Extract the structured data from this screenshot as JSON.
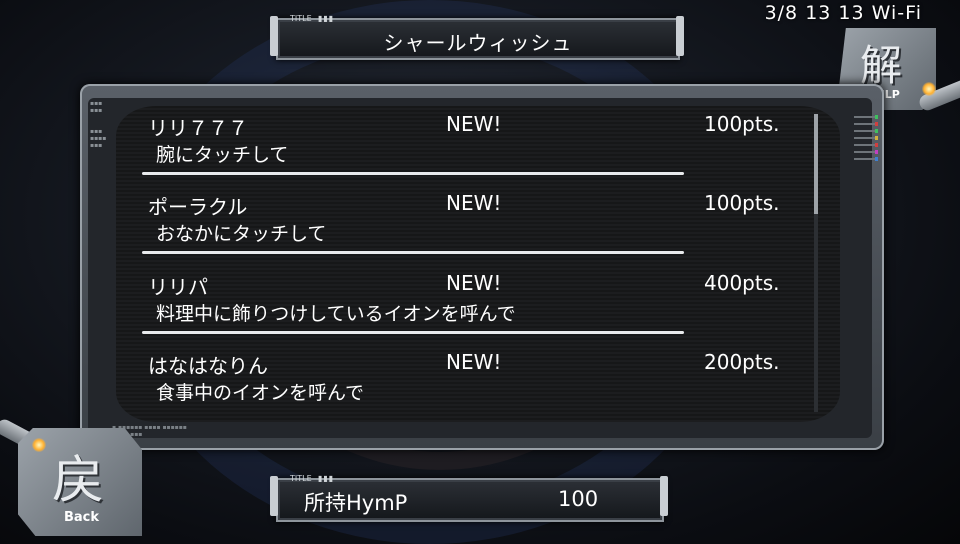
{
  "status_bar": {
    "date": "3/8",
    "hour": "13",
    "minute": "13",
    "network": "Wi-Fi"
  },
  "title_plate": {
    "tag": "TITLE",
    "title": "シャールウィッシュ"
  },
  "help_button": {
    "kanji": "解",
    "label": "HELP"
  },
  "back_button": {
    "kanji": "戻",
    "label": "Back"
  },
  "items": [
    {
      "name": "リリ７７７",
      "badge": "NEW!",
      "points": "100pts.",
      "description": "腕にタッチして"
    },
    {
      "name": "ポーラクル",
      "badge": "NEW!",
      "points": "100pts.",
      "description": "おなかにタッチして"
    },
    {
      "name": "リリパ",
      "badge": "NEW!",
      "points": "400pts.",
      "description": "料理中に飾りつけしているイオンを呼んで"
    },
    {
      "name": "はなはなりん",
      "badge": "NEW!",
      "points": "200pts.",
      "description": "食事中のイオンを呼んで"
    }
  ],
  "scrollbar": {
    "position_fraction": 0.0
  },
  "hymp_plate": {
    "tag": "TITLE",
    "label": "所持HymP",
    "value": "100"
  },
  "colors": {
    "accent_glow": "#ffb030",
    "divider": "#e8eaec",
    "panel": "#23262b"
  }
}
